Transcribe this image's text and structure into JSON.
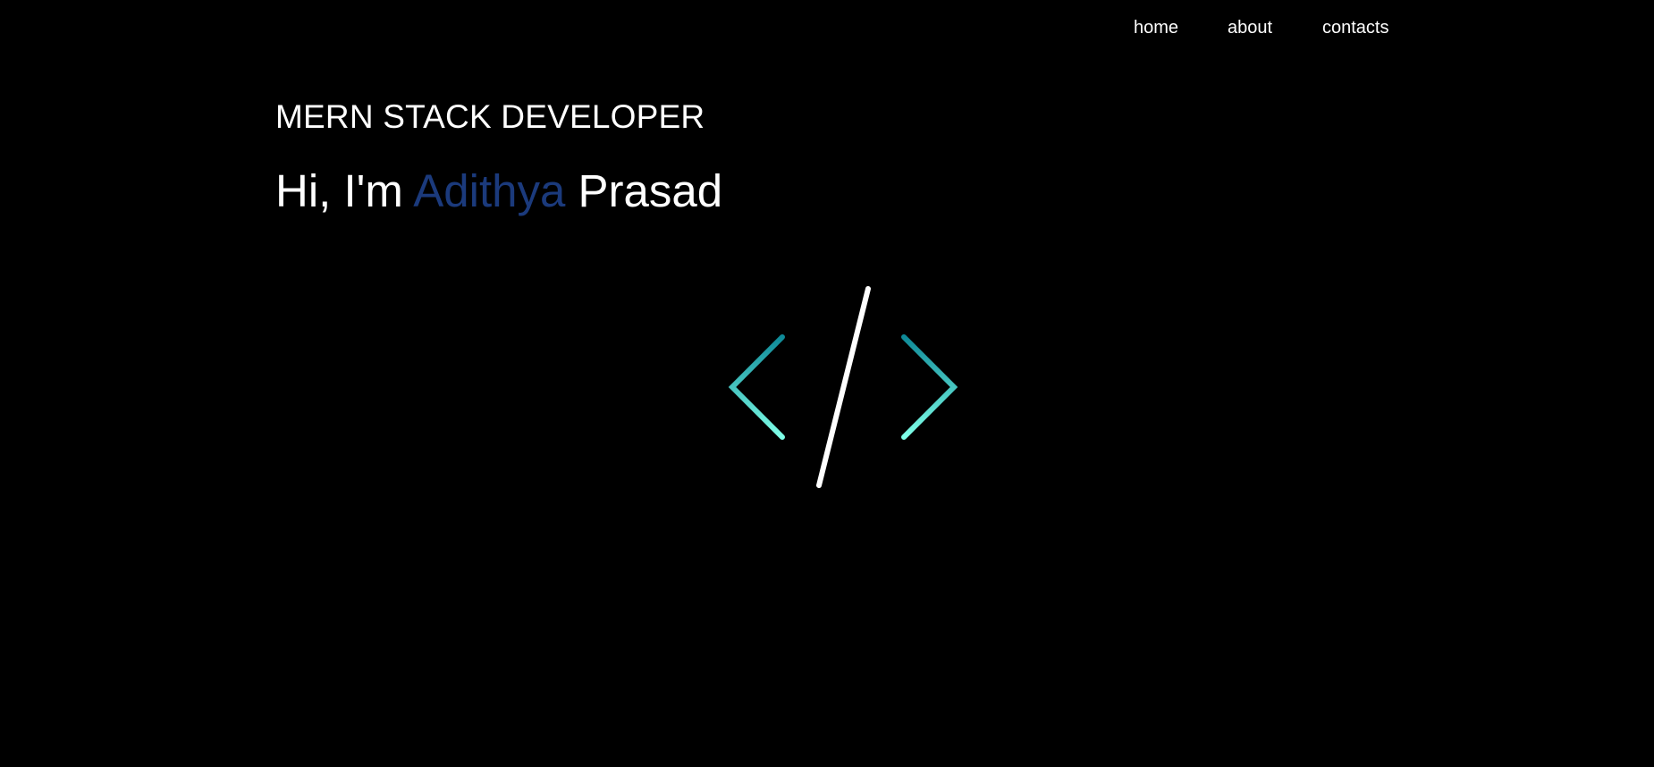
{
  "nav": {
    "items": [
      {
        "label": "home"
      },
      {
        "label": "about"
      },
      {
        "label": "contacts"
      }
    ]
  },
  "hero": {
    "subtitle": "MERN STACK DEVELOPER",
    "greeting": "Hi, I'm",
    "first_name": "Adithya",
    "last_name": "Prasad"
  },
  "logo": {
    "icon": "code-brackets-icon",
    "bracket_color_start": "#0e8a98",
    "bracket_color_end": "#7fffe8",
    "slash_color": "#ffffff"
  },
  "colors": {
    "background": "#000000",
    "text": "#ffffff",
    "accent": "#1b3a7c"
  }
}
